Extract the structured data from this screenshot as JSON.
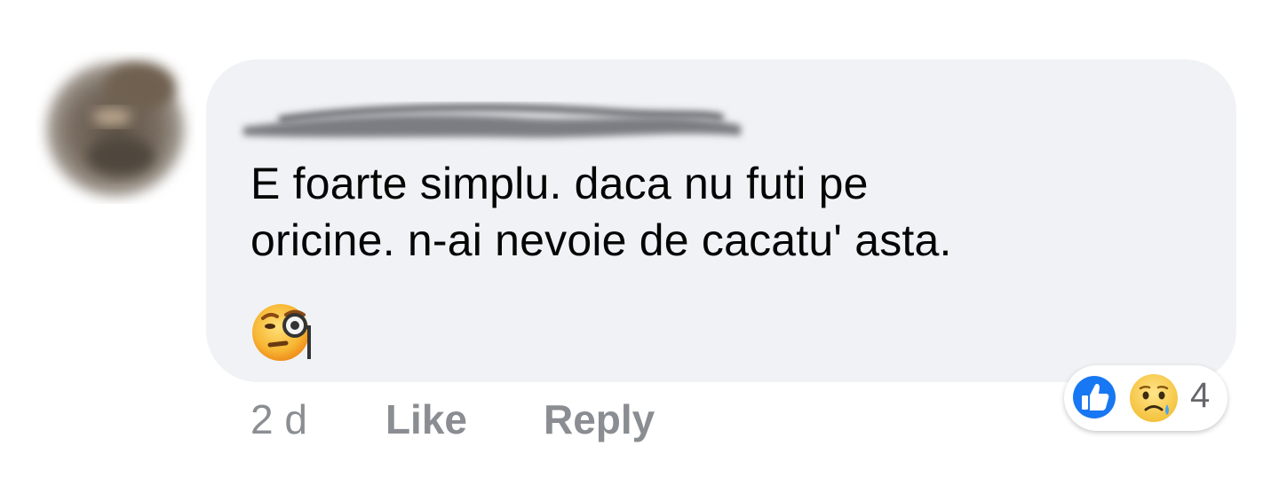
{
  "comment": {
    "text_line1": "E foarte simplu. daca nu futi pe",
    "text_line2": "oricine. n-ai nevoie de cacatu' asta.",
    "emoji": "monocle-face-emoji"
  },
  "actions": {
    "timestamp": "2 d",
    "like_label": "Like",
    "reply_label": "Reply"
  },
  "reactions": {
    "types": [
      "like-icon",
      "sad-icon"
    ],
    "count": "4"
  },
  "colors": {
    "bubble_bg": "#f0f2f5",
    "text": "#050505",
    "meta_text": "#8a8d91",
    "like_blue": "#1877f2",
    "emoji_yellow": "#f7c846"
  }
}
